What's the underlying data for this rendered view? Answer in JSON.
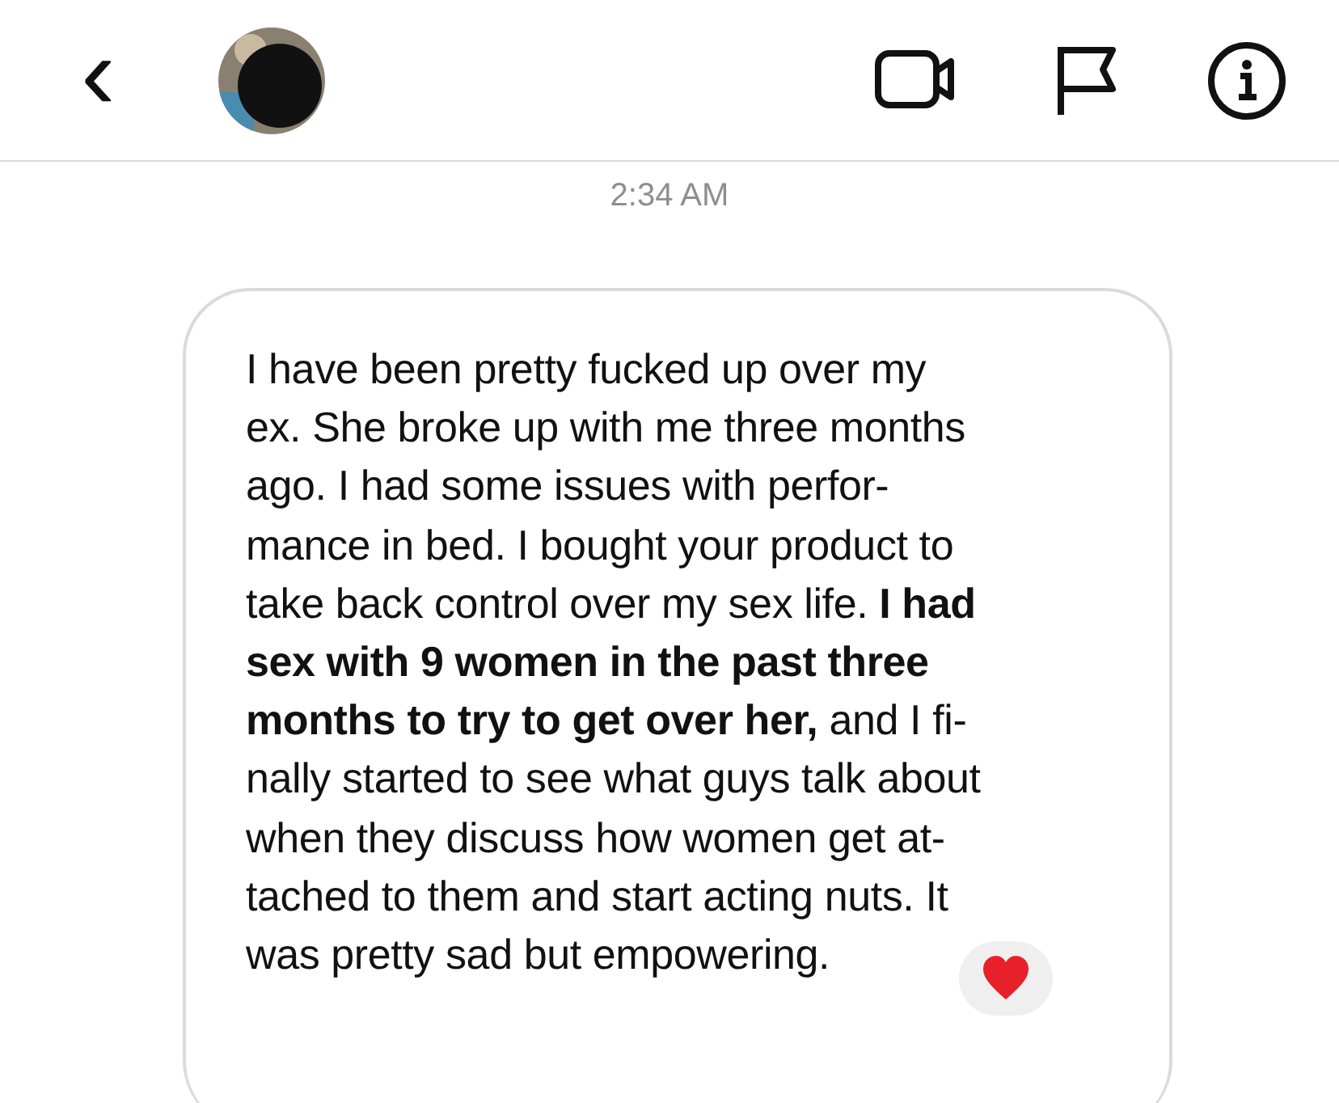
{
  "header": {
    "back": "‹"
  },
  "timestamp": "2:34 AM",
  "message": {
    "text": "I have been pretty fucked up over my\nex. She broke up with me three months\nago. I had some issues with perfor-\nmance in bed. I bought your product to\ntake back control over my sex life. **I had\nsex with 9 women in the past three\nmonths to try to get over her,** and I fi-\nnally started to see what guys talk about\nwhen they discuss how women get at-\ntached to them and start acting nuts. It\nwas pretty sad but empowering.",
    "reacted": true
  }
}
